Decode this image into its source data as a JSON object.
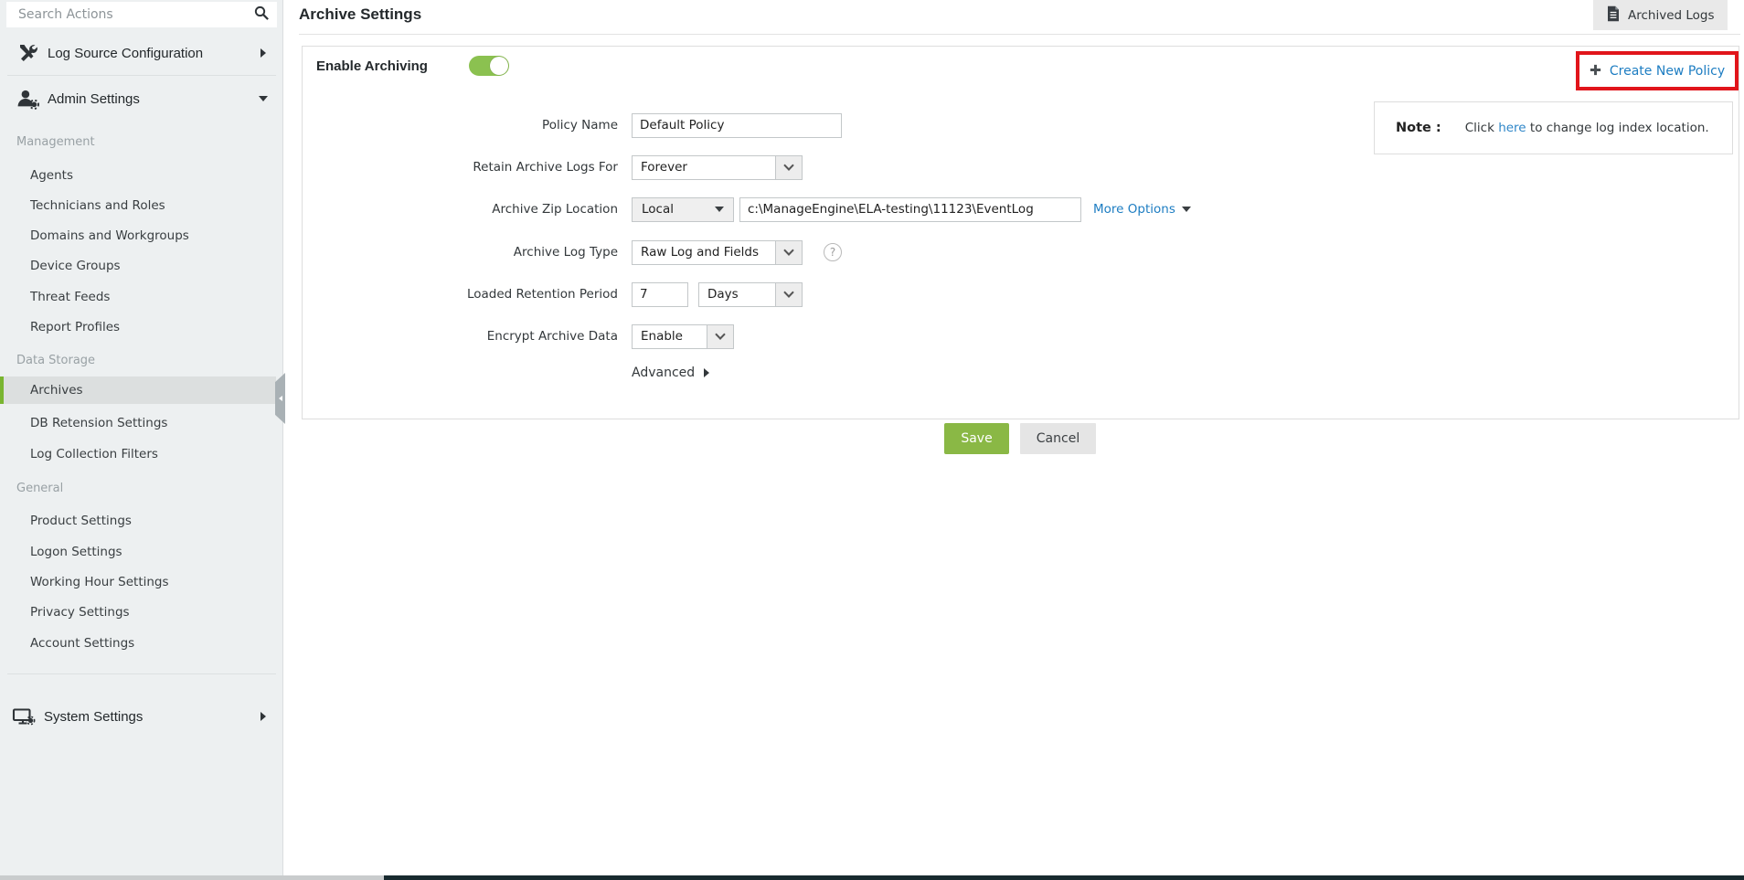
{
  "sidebar": {
    "search_placeholder": "Search Actions",
    "log_source_label": "Log Source Configuration",
    "admin_settings_label": "Admin Settings",
    "sections": [
      {
        "title": "Management",
        "items": [
          "Agents",
          "Technicians and Roles",
          "Domains and Workgroups",
          "Device Groups",
          "Threat Feeds",
          "Report Profiles"
        ]
      },
      {
        "title": "Data Storage",
        "items": [
          "Archives",
          "DB Retension Settings",
          "Log Collection Filters"
        ]
      },
      {
        "title": "General",
        "items": [
          "Product Settings",
          "Logon Settings",
          "Working Hour Settings",
          "Privacy Settings",
          "Account Settings"
        ]
      }
    ],
    "selected_item": "Archives",
    "system_settings_label": "System Settings"
  },
  "header": {
    "title": "Archive Settings",
    "archived_logs_label": "Archived Logs"
  },
  "panel": {
    "enable_archiving_label": "Enable Archiving",
    "enable_archiving_state": "on",
    "create_new_policy_label": "Create New Policy",
    "form": {
      "policy_name": {
        "label": "Policy Name",
        "value": "Default Policy"
      },
      "retain": {
        "label": "Retain Archive Logs For",
        "value": "Forever"
      },
      "zip_location": {
        "label": "Archive Zip Location",
        "location_type": "Local",
        "path": "c:\\ManageEngine\\ELA-testing\\11123\\EventLog",
        "more_options_label": "More Options"
      },
      "log_type": {
        "label": "Archive Log Type",
        "value": "Raw Log and Fields"
      },
      "retention": {
        "label": "Loaded Retention Period",
        "value": "7",
        "unit": "Days"
      },
      "encrypt": {
        "label": "Encrypt Archive Data",
        "value": "Enable"
      },
      "advanced_label": "Advanced"
    },
    "note": {
      "prefix": "Note :",
      "before_link": "Click",
      "link": "here",
      "after_link": "to change log index location."
    }
  },
  "buttons": {
    "save": "Save",
    "cancel": "Cancel"
  },
  "icons": {
    "help": "?"
  },
  "colors": {
    "toggle_green": "#8bc150",
    "save_green": "#8ab845",
    "link_blue": "#1d7dc2",
    "highlight_red": "#e1151b",
    "selected_bar_green": "#79b530",
    "sidebar_bg": "#edf0f1"
  }
}
